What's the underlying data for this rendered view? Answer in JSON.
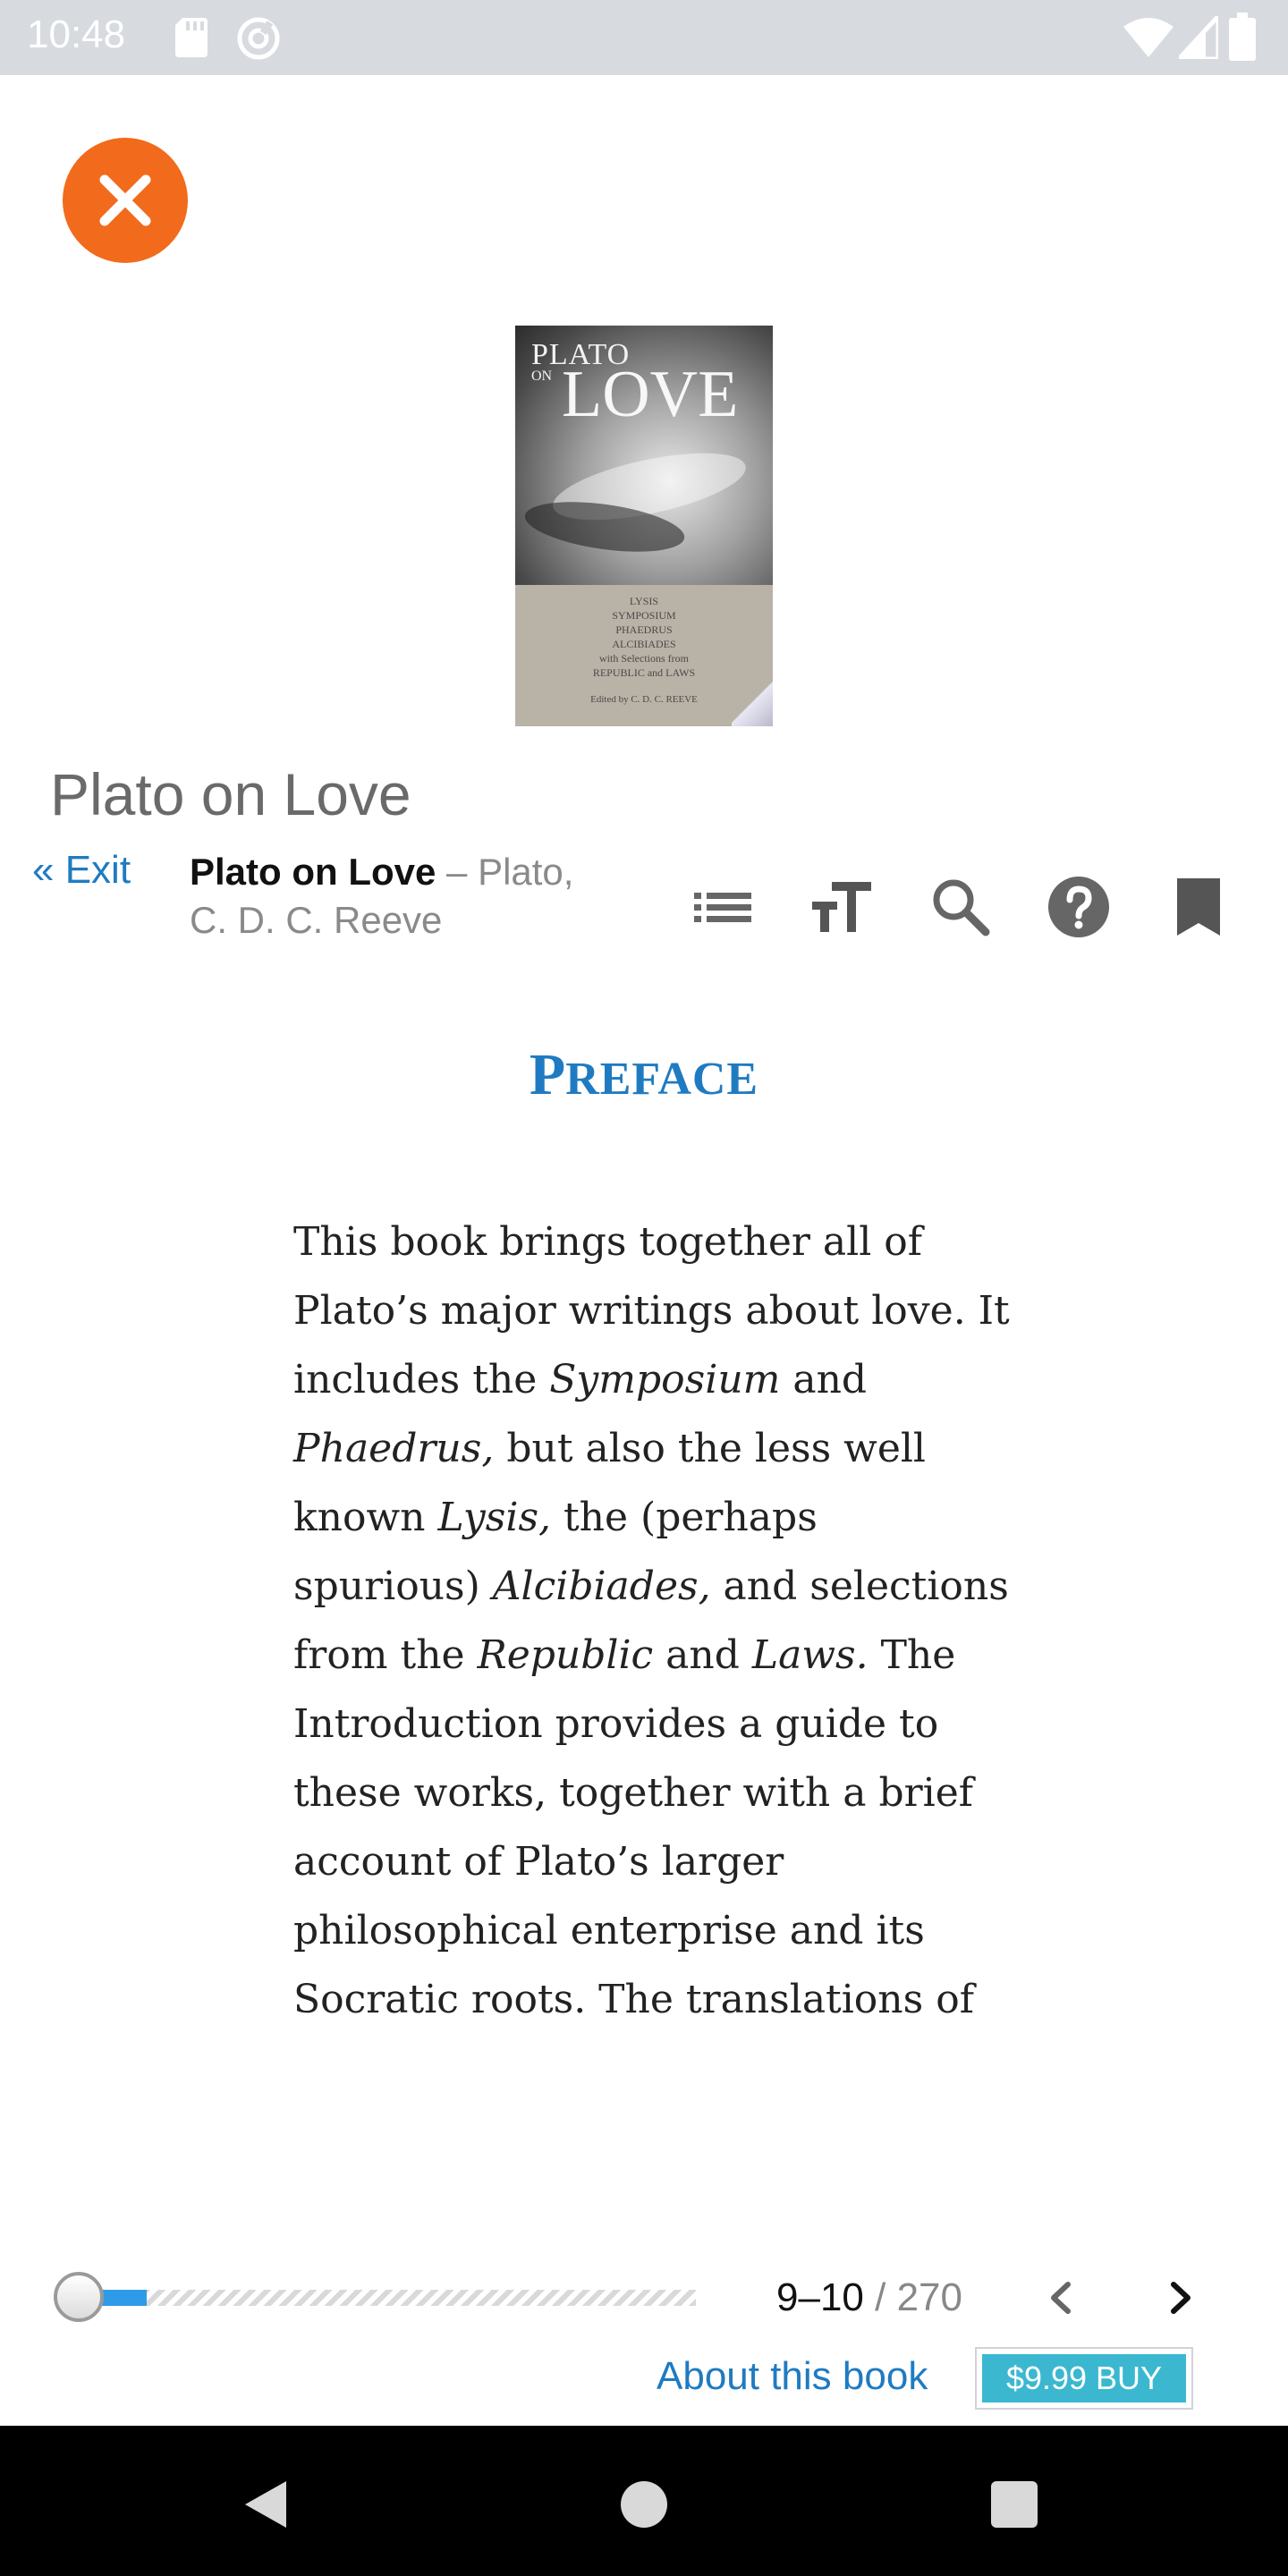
{
  "status_bar": {
    "time": "10:48",
    "icons": [
      "sd-card-icon",
      "sync-icon",
      "wifi-icon",
      "signal-icon",
      "battery-icon"
    ]
  },
  "close_button": {
    "icon": "close-icon",
    "color": "#f26a1b"
  },
  "cover": {
    "title_line1": "PLATO",
    "title_line2": "ON",
    "title_line3": "LOVE",
    "contents": [
      "LYSIS",
      "SYMPOSIUM",
      "PHAEDRUS",
      "ALCIBIADES",
      "with Selections from",
      "REPUBLIC and LAWS"
    ],
    "editor": "Edited by C. D. C. REEVE"
  },
  "book_heading": "Plato on Love",
  "toolbar": {
    "exit_label": "« Exit",
    "title": "Plato on Love",
    "separator": " – ",
    "author_line1": "Plato,",
    "author_line2": "C. D. C. Reeve",
    "icons": [
      "toc-icon",
      "font-size-icon",
      "search-icon",
      "help-icon",
      "bookmark-icon"
    ]
  },
  "content": {
    "chapter_title_first": "P",
    "chapter_title_rest": "REFACE",
    "lines": [
      [
        "This book brings together all of"
      ],
      [
        "Plato’s major writings about love. It"
      ],
      [
        "includes the ",
        {
          "i": "Symposium"
        },
        " and"
      ],
      [
        {
          "i": "Phaedrus,"
        },
        " but also the less well"
      ],
      [
        "known ",
        {
          "i": "Lysis,"
        },
        " the (perhaps"
      ],
      [
        "spurious) ",
        {
          "i": "Alcibiades,"
        },
        " and selections"
      ],
      [
        "from the ",
        {
          "i": "Republic"
        },
        " and ",
        {
          "i": "Laws."
        },
        " The"
      ],
      [
        "Introduction provides a guide to"
      ],
      [
        "these works, together with a brief"
      ],
      [
        "account of Plato’s larger"
      ],
      [
        "philosophical enterprise and its"
      ],
      [
        "Socratic roots. The translations of"
      ]
    ]
  },
  "footer": {
    "progress_fraction": 0.11,
    "page_current": "9–10",
    "page_total": " / 270",
    "about_label": "About this book",
    "buy_label": "$9.99 BUY",
    "accent_color": "#1f7bc1",
    "buy_color": "#3bb8d0",
    "progress_color": "#2f9be8"
  },
  "nav_bar": {
    "icons": [
      "back-icon",
      "home-icon",
      "recent-apps-icon"
    ]
  }
}
